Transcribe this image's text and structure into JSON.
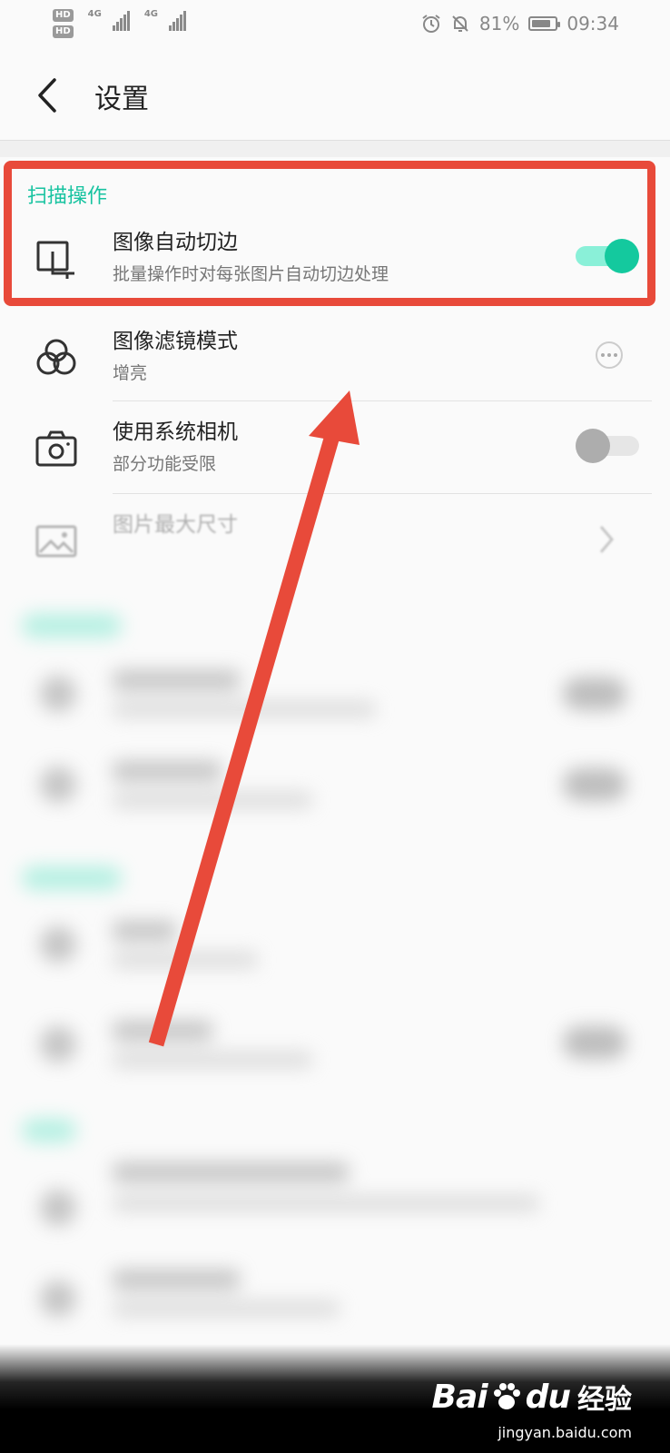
{
  "status_bar": {
    "hd1": "HD",
    "hd2": "HD",
    "net1": "4G",
    "net2": "4G",
    "battery_percent": "81%",
    "battery_level": 0.81,
    "time": "09:34"
  },
  "header": {
    "title": "设置"
  },
  "section": {
    "title": "扫描操作"
  },
  "rows": [
    {
      "title": "图像自动切边",
      "subtitle": "批量操作时对每张图片自动切边处理",
      "control": "toggle",
      "on": true
    },
    {
      "title": "图像滤镜模式",
      "subtitle": "增亮",
      "control": "more"
    },
    {
      "title": "使用系统相机",
      "subtitle": "部分功能受限",
      "control": "toggle",
      "on": false
    },
    {
      "title": "图片最大尺寸",
      "subtitle": "",
      "control": "chevron"
    }
  ],
  "watermark": {
    "brand": "Bai",
    "brand2": "du",
    "cn": "经验",
    "url": "jingyan.baidu.com"
  },
  "colors": {
    "accent": "#14c99e",
    "highlight": "#e84a3a"
  }
}
